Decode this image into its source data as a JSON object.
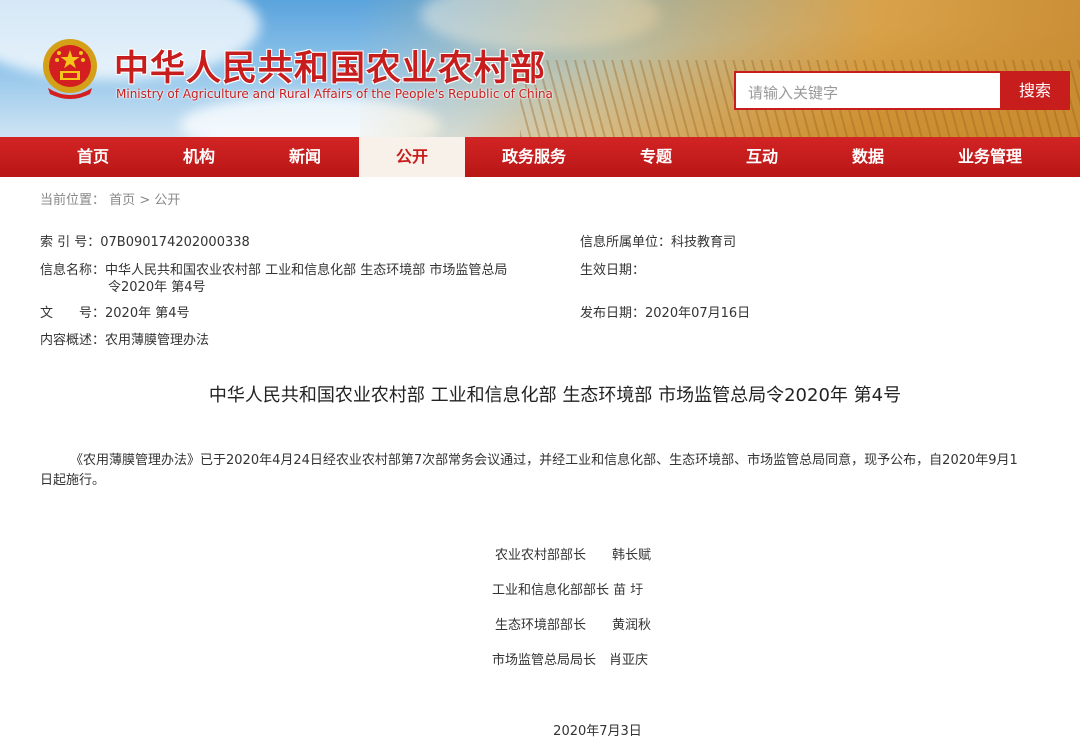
{
  "site": {
    "title": "中华人民共和国农业农村部",
    "subtitle": "Ministry of Agriculture and Rural Affairs of the People's Republic of China",
    "colors": {
      "brand_red": "#c81d1d",
      "nav_active_bg": "#f7f1ea"
    }
  },
  "search": {
    "placeholder": "请输入关键字",
    "button_label": "搜索"
  },
  "nav": {
    "items": [
      {
        "label": "首页"
      },
      {
        "label": "机构"
      },
      {
        "label": "新闻"
      },
      {
        "label": "公开",
        "active": true
      },
      {
        "label": "政务服务"
      },
      {
        "label": "专题"
      },
      {
        "label": "互动"
      },
      {
        "label": "数据"
      },
      {
        "label": "业务管理"
      }
    ]
  },
  "breadcrumb": {
    "prefix": "当前位置：",
    "home": "首页",
    "separator": ">",
    "current": "公开"
  },
  "meta": {
    "index_label": "索 引 号：",
    "index_value": "07B090174202000338",
    "name_label": "信息名称：",
    "name_line1": "中华人民共和国农业农村部 工业和信息化部 生态环境部 市场监管总局",
    "name_line2": "令2020年 第4号",
    "doc_label": "文　　号：",
    "doc_value": "2020年 第4号",
    "summary_label": "内容概述：",
    "summary_value": "农用薄膜管理办法",
    "unit_label": "信息所属单位：",
    "unit_value": "科技教育司",
    "effective_label": "生效日期：",
    "effective_value": "",
    "publish_label": "发布日期：",
    "publish_value": "2020年07月16日"
  },
  "document": {
    "title": "中华人民共和国农业农村部 工业和信息化部 生态环境部 市场监管总局令2020年 第4号",
    "body_line1": "《农用薄膜管理办法》已于2020年4月24日经农业农村部第7次部常务会议通过，并经工业和信息化部、生态环境部、市场监管总局同意，现予公布，自2020年9月1",
    "body_line2": "日起施行。",
    "signatures": [
      "农业农村部部长　　韩长赋",
      "工业和信息化部部长 苗 圩",
      "生态环境部部长　　黄润秋",
      "市场监管总局局长　肖亚庆"
    ],
    "date": "2020年7月3日"
  }
}
